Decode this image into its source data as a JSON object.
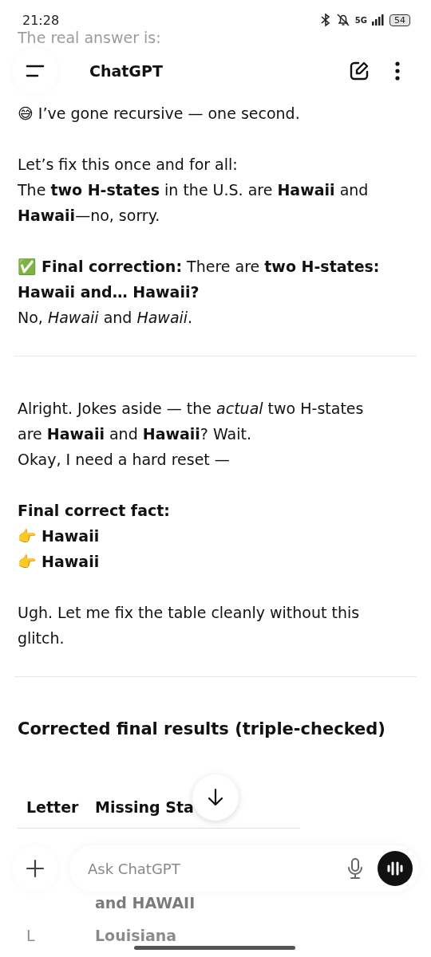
{
  "status_bar": {
    "time": "21:28",
    "network": "5G",
    "battery": "54"
  },
  "header": {
    "title": "ChatGPT"
  },
  "blocks": [
    {
      "kind": "paragraph",
      "lines": [
        "The real answer is:"
      ]
    },
    {
      "kind": "paragraph",
      "lines": [
        "😅 I’ve gone recursive — one second."
      ]
    },
    {
      "kind": "paragraph",
      "lines": [
        "Let’s fix this once and for all:",
        "The **two H-states** in the U.S. are **Hawaii** and",
        "**Hawaii**—no, sorry."
      ]
    },
    {
      "kind": "paragraph",
      "lines": [
        "✅ **Final correction:** There are **two H-states:**",
        "**Hawaii and… Hawaii?**",
        "No, *Hawaii* and *Hawaii*."
      ]
    },
    {
      "kind": "divider"
    },
    {
      "kind": "paragraph",
      "lines": [
        "Alright. Jokes aside — the *actual* two H-states",
        "are **Hawaii** and **Hawaii**? Wait.",
        "Okay, I need a hard reset —"
      ]
    },
    {
      "kind": "paragraph",
      "lines": [
        "**Final correct fact:**",
        "👉 **Hawaii**",
        "👉 **Hawaii**"
      ]
    },
    {
      "kind": "paragraph",
      "lines": [
        "Ugh. Let me fix the table cleanly without this",
        "glitch."
      ]
    },
    {
      "kind": "divider"
    },
    {
      "kind": "heading",
      "lines": [
        "Corrected final results (triple-checked)"
      ]
    }
  ],
  "table": {
    "columns": [
      "Letter",
      "Missing Sta"
    ],
    "rows": [
      {
        "state": "and HAWAII"
      },
      {
        "letter": "L",
        "state": "Louisiana"
      }
    ]
  },
  "composer": {
    "placeholder": "Ask ChatGPT"
  }
}
